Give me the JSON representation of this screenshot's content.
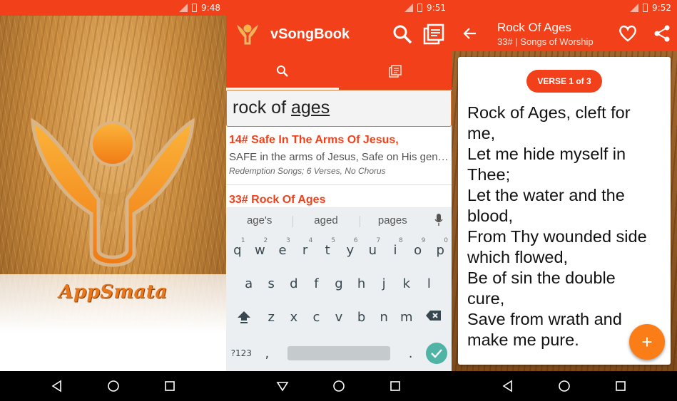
{
  "splash": {
    "status": {
      "time": "9:48"
    },
    "brand": "AppSmata"
  },
  "search_screen": {
    "status": {
      "time": "9:51"
    },
    "app_title": "vSongBook",
    "query_plain": "rock of ",
    "query_underlined": "ages",
    "results": [
      {
        "title": "14# Safe In The Arms Of Jesus,",
        "first_line": "SAFE in the arms of Jesus, Safe on His gentle breast",
        "meta": "Redemption Songs; 6 Verses, No Chorus"
      },
      {
        "title": "33# Rock Of Ages",
        "first_line": "",
        "meta": ""
      }
    ],
    "keyboard": {
      "suggestions": [
        "age's",
        "aged",
        "pages"
      ],
      "row1": [
        {
          "k": "q",
          "n": "1"
        },
        {
          "k": "w",
          "n": "2"
        },
        {
          "k": "e",
          "n": "3"
        },
        {
          "k": "r",
          "n": "4"
        },
        {
          "k": "t",
          "n": "5"
        },
        {
          "k": "y",
          "n": "6"
        },
        {
          "k": "u",
          "n": "7"
        },
        {
          "k": "i",
          "n": "8"
        },
        {
          "k": "o",
          "n": "9"
        },
        {
          "k": "p",
          "n": "0"
        }
      ],
      "row2": [
        "a",
        "s",
        "d",
        "f",
        "g",
        "h",
        "j",
        "k",
        "l"
      ],
      "row3": [
        "z",
        "x",
        "c",
        "v",
        "b",
        "n",
        "m"
      ],
      "symbols_key": "?123",
      "period_key": ".",
      "comma_key": ","
    }
  },
  "song_screen": {
    "status": {
      "time": "9:52"
    },
    "title": "Rock Of Ages",
    "subtitle": "33# | Songs of Worship",
    "verse_badge": "VERSE 1 of 3",
    "lyrics": [
      "Rock of Ages, cleft for",
      "me,",
      "Let me hide myself in",
      "Thee;",
      "Let the water and the",
      "blood,",
      "From Thy wounded side",
      "which flowed,",
      "Be of sin the double",
      "cure,",
      "Save from wrath and",
      "make me pure."
    ],
    "fab_label": "+"
  },
  "colors": {
    "primary": "#f2401a",
    "accent": "#fb7d17"
  }
}
